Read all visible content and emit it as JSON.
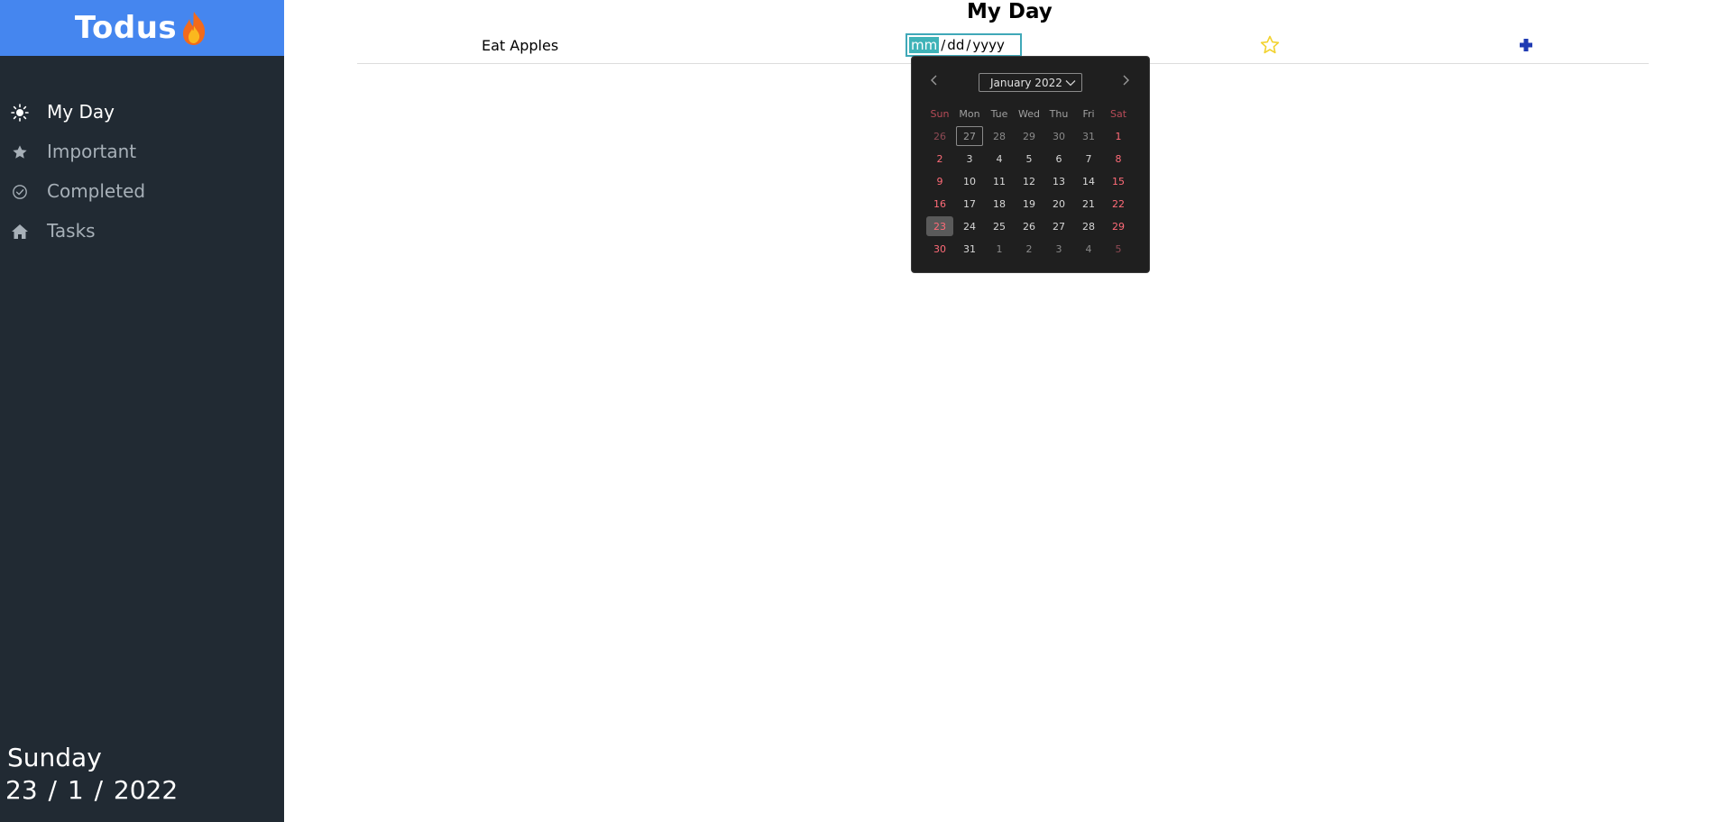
{
  "app": {
    "title": "Todus",
    "logo_icon": "flame-icon"
  },
  "sidebar": {
    "items": [
      {
        "label": "My Day",
        "icon": "sun-icon",
        "active": true
      },
      {
        "label": "Important",
        "icon": "star-icon",
        "active": false
      },
      {
        "label": "Completed",
        "icon": "check-circle-icon",
        "active": false
      },
      {
        "label": "Tasks",
        "icon": "home-icon",
        "active": false
      }
    ],
    "date": {
      "weekday": "Sunday",
      "full": "23 / 1 / 2022"
    }
  },
  "main": {
    "title": "My Day",
    "tasks": [
      {
        "name": "Eat Apples",
        "due_date": {
          "month": "mm",
          "sep1": "/",
          "day": "dd",
          "sep2": "/",
          "year": "yyyy"
        },
        "star_icon": "star-outline-icon",
        "add_icon": "plus-icon"
      }
    ]
  },
  "datepicker": {
    "month_label": "January 2022",
    "weekdays": [
      "Sun",
      "Mon",
      "Tue",
      "Wed",
      "Thu",
      "Fri",
      "Sat"
    ],
    "weeks": [
      [
        "26",
        "27",
        "28",
        "29",
        "30",
        "31",
        "1"
      ],
      [
        "2",
        "3",
        "4",
        "5",
        "6",
        "7",
        "8"
      ],
      [
        "9",
        "10",
        "11",
        "12",
        "13",
        "14",
        "15"
      ],
      [
        "16",
        "17",
        "18",
        "19",
        "20",
        "21",
        "22"
      ],
      [
        "23",
        "24",
        "25",
        "26",
        "27",
        "28",
        "29"
      ],
      [
        "30",
        "31",
        "1",
        "2",
        "3",
        "4",
        "5"
      ]
    ],
    "today": "27",
    "selected": "23"
  },
  "colors": {
    "sidebar_bg": "#212a33",
    "brand_bg": "#4586ef",
    "accent_teal": "#3fb3b8",
    "star_yellow": "#f2d22e",
    "plus_blue": "#1f3bb3",
    "weekend_red": "#ff6b78"
  }
}
